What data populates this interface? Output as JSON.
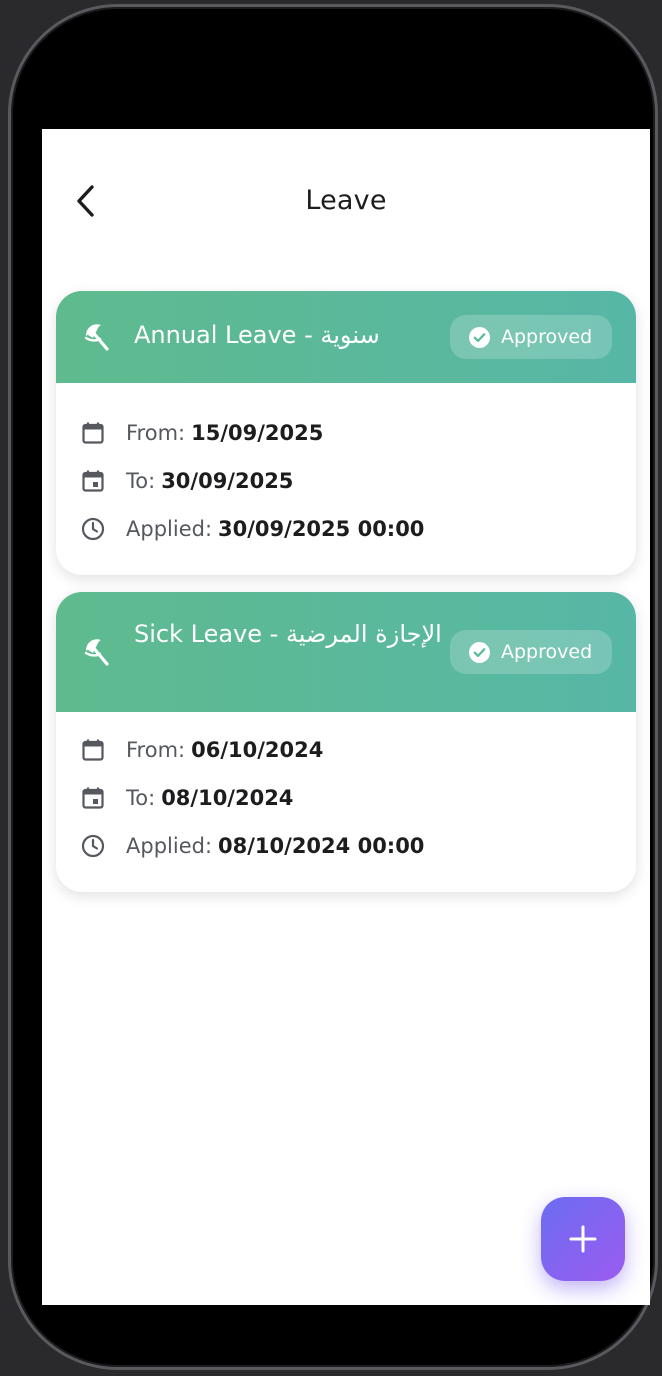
{
  "header": {
    "title": "Leave"
  },
  "leaves": [
    {
      "type": "Annual Leave - سنوية",
      "status": "Approved",
      "from_label": "From:",
      "from": "15/09/2025",
      "to_label": "To:",
      "to": "30/09/2025",
      "applied_label": "Applied:",
      "applied": "30/09/2025 00:00"
    },
    {
      "type": "Sick Leave - الإجازة المرضية",
      "status": "Approved",
      "from_label": "From:",
      "from": "06/10/2024",
      "to_label": "To:",
      "to": "08/10/2024",
      "applied_label": "Applied:",
      "applied": "08/10/2024 00:00"
    }
  ],
  "colors": {
    "card_header_start": "#5fba8e",
    "card_header_end": "#57b7a6",
    "fab_start": "#6c6cf2",
    "fab_end": "#9b5cf0"
  },
  "icons": [
    "back-arrow-icon",
    "beach-umbrella-icon",
    "check-circle-icon",
    "calendar-icon",
    "calendar-event-icon",
    "clock-icon",
    "plus-icon"
  ]
}
